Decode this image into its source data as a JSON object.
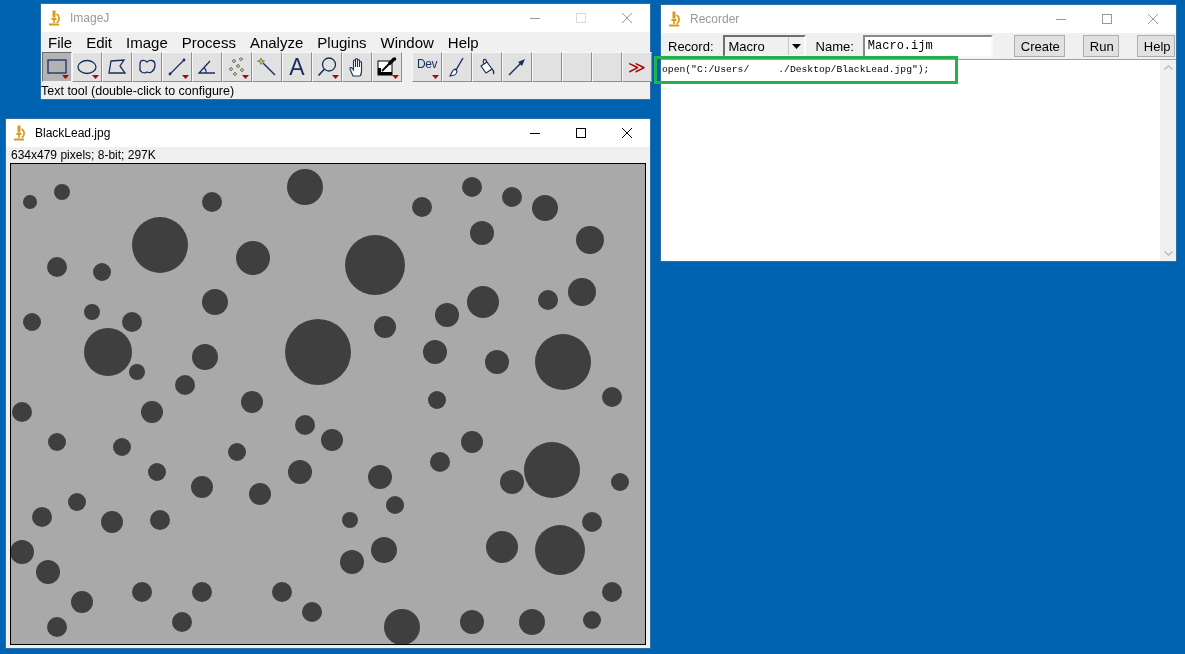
{
  "imagej_window": {
    "title": "ImageJ",
    "active": false,
    "maximize_disabled": true,
    "menu": [
      "File",
      "Edit",
      "Image",
      "Process",
      "Analyze",
      "Plugins",
      "Window",
      "Help"
    ],
    "tools": [
      {
        "kind": "rectangle",
        "selected": true,
        "menu": true
      },
      {
        "kind": "oval",
        "selected": false,
        "menu": true
      },
      {
        "kind": "polygon",
        "selected": false,
        "menu": false
      },
      {
        "kind": "freehand",
        "selected": false,
        "menu": false
      },
      {
        "kind": "line",
        "selected": false,
        "menu": true
      },
      {
        "kind": "angle",
        "selected": false,
        "menu": false
      },
      {
        "kind": "multipoint",
        "selected": false,
        "menu": true
      },
      {
        "kind": "wand",
        "selected": false,
        "menu": false
      },
      {
        "kind": "text",
        "label": "A",
        "selected": false,
        "menu": false
      },
      {
        "kind": "magnifier",
        "selected": false,
        "menu": true
      },
      {
        "kind": "hand",
        "selected": false,
        "menu": false
      },
      {
        "kind": "dropper",
        "selected": false,
        "menu": true
      }
    ],
    "macro_tools": [
      {
        "kind": "dev",
        "label": "Dev",
        "selected": false,
        "menu": true
      },
      {
        "kind": "brush",
        "selected": false,
        "menu": false
      },
      {
        "kind": "fill",
        "selected": false,
        "menu": false
      },
      {
        "kind": "arrow",
        "selected": false,
        "menu": false
      },
      {
        "kind": "blank",
        "selected": false,
        "menu": false
      },
      {
        "kind": "blank",
        "selected": false,
        "menu": false
      },
      {
        "kind": "blank",
        "selected": false,
        "menu": false
      },
      {
        "kind": "more",
        "label": "≫",
        "selected": false,
        "menu": false
      }
    ],
    "status_bar": "Text tool (double-click to configure)"
  },
  "recorder_window": {
    "title": "Recorder",
    "active": false,
    "maximize_disabled": false,
    "record": {
      "label": "Record:",
      "value": "Macro"
    },
    "name": {
      "label": "Name:",
      "value": "Macro.ijm"
    },
    "buttons": [
      "Create",
      "Run",
      "Help"
    ],
    "lines": [
      "open(\"C:/Users/     ./Desktop/BlackLead.jpg\");"
    ]
  },
  "image_window": {
    "title": "BlackLead.jpg",
    "active": true,
    "maximize_disabled": false,
    "info": "634x479 pixels; 8-bit; 297K"
  }
}
